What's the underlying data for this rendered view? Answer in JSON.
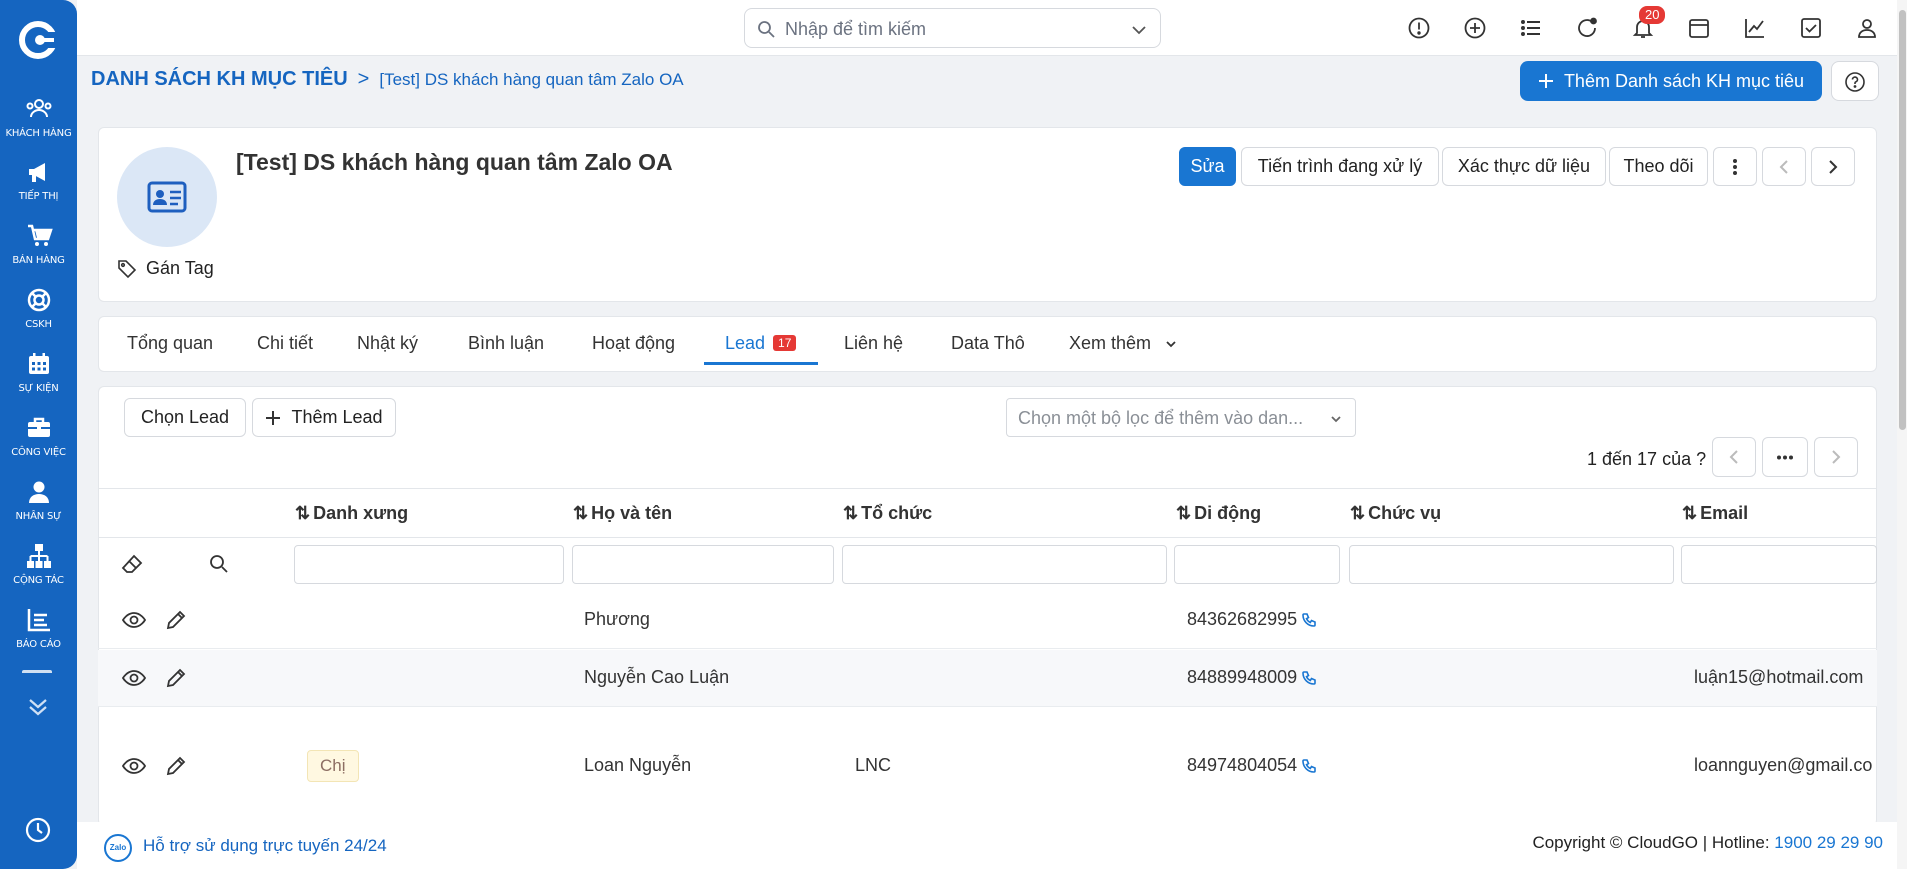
{
  "sidebar": {
    "items": [
      {
        "label": "Khách hàng",
        "icon": "users-icon"
      },
      {
        "label": "Tiếp thị",
        "icon": "megaphone-icon"
      },
      {
        "label": "Bán hàng",
        "icon": "cart-icon"
      },
      {
        "label": "CSKH",
        "icon": "lifebuoy-icon"
      },
      {
        "label": "Sự kiện",
        "icon": "calendar-grid-icon"
      },
      {
        "label": "Công việc",
        "icon": "briefcase-icon"
      },
      {
        "label": "Nhân sự",
        "icon": "person-icon"
      },
      {
        "label": "Cộng tác",
        "icon": "org-chart-icon"
      },
      {
        "label": "Báo cáo",
        "icon": "report-icon"
      }
    ]
  },
  "topbar": {
    "search_placeholder": "Nhập để tìm kiếm",
    "notification_count": "20"
  },
  "breadcrumb": {
    "root": "DANH SÁCH KH MỤC TIÊU",
    "separator": ">",
    "current": "[Test] DS khách hàng quan tâm Zalo OA"
  },
  "add_list_button": "Thêm Danh sách KH mục tiêu",
  "record": {
    "title": "[Test] DS khách hàng quan tâm Zalo OA",
    "tag_label": "Gán Tag",
    "buttons": {
      "edit": "Sửa",
      "processing": "Tiến trình đang xử lý",
      "verify": "Xác thực dữ liệu",
      "follow": "Theo dõi"
    }
  },
  "tabs": [
    {
      "label": "Tổng quan"
    },
    {
      "label": "Chi tiết"
    },
    {
      "label": "Nhật ký"
    },
    {
      "label": "Bình luận"
    },
    {
      "label": "Hoạt động"
    },
    {
      "label": "Lead",
      "badge": "17",
      "active": true
    },
    {
      "label": "Liên hệ"
    },
    {
      "label": "Data Thô"
    },
    {
      "label": "Xem thêm"
    }
  ],
  "list": {
    "select_button": "Chọn Lead",
    "add_button": "Thêm Lead",
    "filter_placeholder": "Chọn một bộ lọc để thêm vào dan...",
    "paging": "1 đến 17 của",
    "paging_suffix": "?",
    "columns": [
      "Danh xưng",
      "Họ và tên",
      "Tổ chức",
      "Di động",
      "Chức vụ",
      "Email"
    ],
    "rows": [
      {
        "salutation": "",
        "name": "Phương",
        "org": "",
        "mobile": "84362682995",
        "position": "",
        "email": ""
      },
      {
        "salutation": "",
        "name": "Nguyễn Cao Luận",
        "org": "",
        "mobile": "84889948009",
        "position": "",
        "email": "luận15@hotmail.com"
      },
      {
        "salutation": "Chị",
        "name": "Loan Nguyễn",
        "org": "LNC",
        "mobile": "84974804054",
        "position": "",
        "email": "loannguyen@gmail.co"
      }
    ]
  },
  "footer": {
    "zalo_logo": "Zalo",
    "support": "Hỗ trợ sử dụng trực tuyến 24/24",
    "copyright": "Copyright © CloudGO",
    "hotline_label": "Hotline:",
    "hotline": "1900 29 29 90"
  },
  "colors": {
    "primary": "#1976d2",
    "sidebar": "#1565c0",
    "badge": "#e53935"
  }
}
